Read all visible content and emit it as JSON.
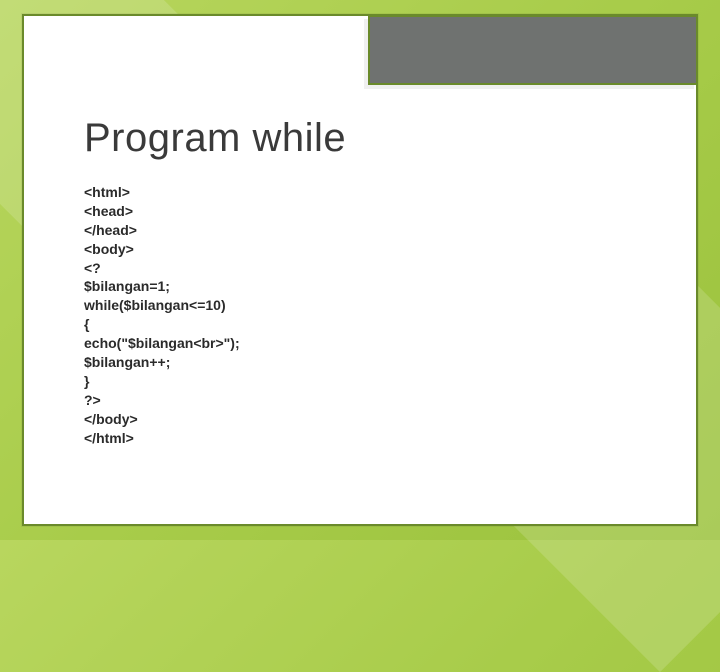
{
  "slide": {
    "title": "Program while",
    "code_lines": [
      "<html>",
      "<head>",
      "</head>",
      "<body>",
      "<?",
      "$bilangan=1;",
      "while($bilangan<=10)",
      "{",
      "echo(\"$bilangan<br>\");",
      "$bilangan++;",
      "}",
      "?>",
      "</body>",
      "</html>"
    ]
  }
}
